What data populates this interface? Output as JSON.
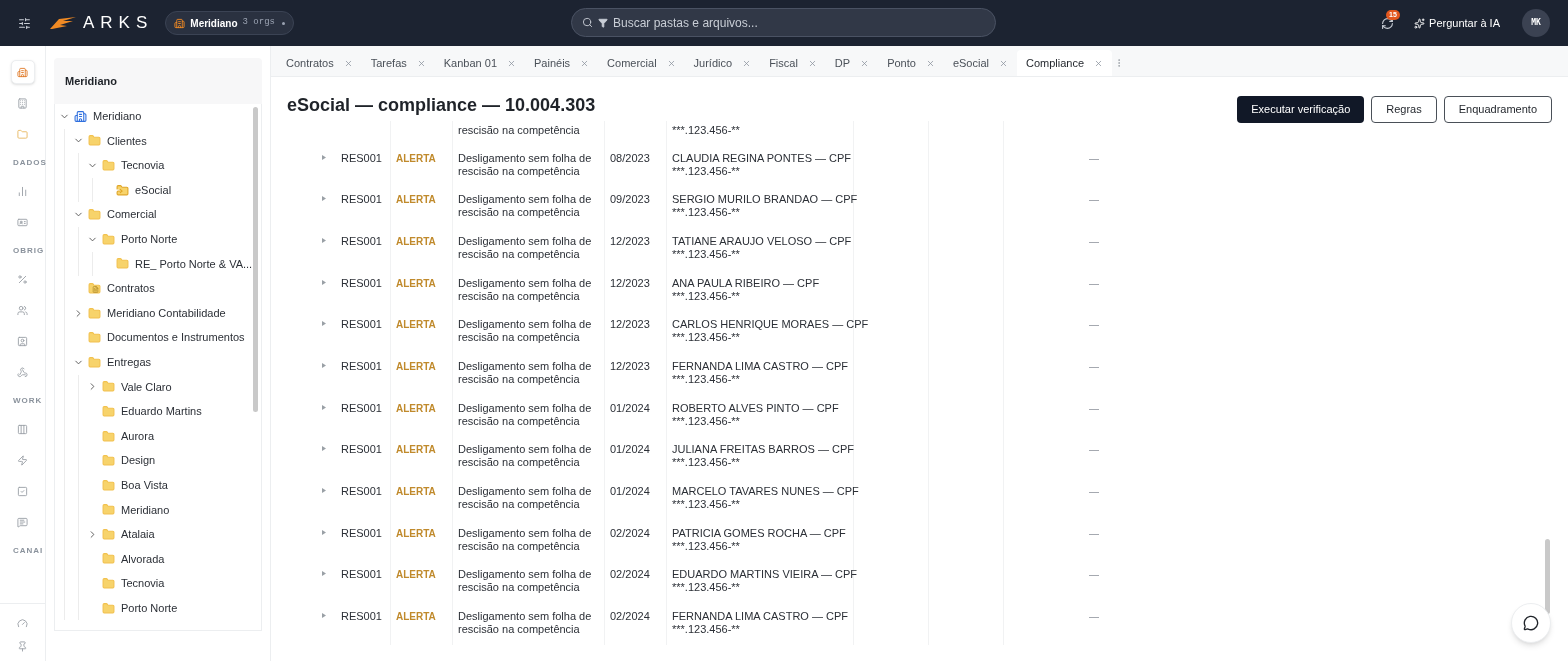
{
  "topbar": {
    "logo": "ARKS",
    "org": {
      "name": "Meridiano",
      "count": "3 orgs"
    },
    "search": {
      "placeholder": "Buscar pastas e arquivos..."
    },
    "notifications": {
      "badge": "15"
    },
    "ask_ai": "Perguntar à IA",
    "avatar": "MK"
  },
  "rail": [
    {
      "kind": "button",
      "selected": true
    },
    {
      "kind": "button",
      "selected": false
    },
    {
      "kind": "button",
      "selected": false
    },
    {
      "kind": "section",
      "label": "DADOS"
    },
    {
      "kind": "button",
      "selected": false
    },
    {
      "kind": "button",
      "selected": false
    },
    {
      "kind": "section",
      "label": "OBRIG"
    },
    {
      "kind": "button",
      "selected": false
    },
    {
      "kind": "button",
      "selected": false
    },
    {
      "kind": "button",
      "selected": false
    },
    {
      "kind": "button",
      "selected": false
    },
    {
      "kind": "section",
      "label": "WORK"
    },
    {
      "kind": "button",
      "selected": false
    },
    {
      "kind": "button",
      "selected": false
    },
    {
      "kind": "button",
      "selected": false
    },
    {
      "kind": "button",
      "selected": false
    },
    {
      "kind": "section",
      "label": "CANAI"
    }
  ],
  "sidebar": {
    "title": "Meridiano",
    "tree": [
      {
        "label": "Meridiano",
        "kind": "org",
        "expanded": true,
        "children": [
          {
            "label": "Clientes",
            "kind": "folder",
            "expanded": true,
            "children": [
              {
                "label": "Tecnovia",
                "kind": "folder",
                "expanded": true,
                "children": [
                  {
                    "label": "eSocial",
                    "kind": "shared-folder"
                  }
                ]
              }
            ]
          },
          {
            "label": "Comercial",
            "kind": "folder",
            "expanded": true,
            "children": [
              {
                "label": "Porto Norte",
                "kind": "folder",
                "expanded": true,
                "children": [
                  {
                    "label": "RE_ Porto Norte & VA...",
                    "kind": "folder"
                  }
                ]
              }
            ]
          },
          {
            "label": "Contratos",
            "kind": "doc-folder"
          },
          {
            "label": "Meridiano Contabilidade",
            "kind": "folder",
            "expanded": false
          },
          {
            "label": "Documentos e Instrumentos",
            "kind": "folder"
          },
          {
            "label": "Entregas",
            "kind": "folder",
            "expanded": true,
            "children": [
              {
                "label": "Vale Claro",
                "kind": "folder",
                "expanded": false
              },
              {
                "label": "Eduardo Martins",
                "kind": "folder"
              },
              {
                "label": "Aurora",
                "kind": "folder"
              },
              {
                "label": "Design",
                "kind": "folder"
              },
              {
                "label": "Boa Vista",
                "kind": "folder"
              },
              {
                "label": "Meridiano",
                "kind": "folder"
              },
              {
                "label": "Atalaia",
                "kind": "folder",
                "expanded": false
              },
              {
                "label": "Alvorada",
                "kind": "folder"
              },
              {
                "label": "Tecnovia",
                "kind": "folder"
              },
              {
                "label": "Porto Norte",
                "kind": "folder"
              }
            ]
          }
        ]
      }
    ]
  },
  "tabs": [
    {
      "label": "Contratos",
      "selected": false
    },
    {
      "label": "Tarefas",
      "selected": false
    },
    {
      "label": "Kanban 01",
      "selected": false
    },
    {
      "label": "Painéis",
      "selected": false
    },
    {
      "label": "Comercial",
      "selected": false
    },
    {
      "label": "Jurídico",
      "selected": false
    },
    {
      "label": "Fiscal",
      "selected": false
    },
    {
      "label": "DP",
      "selected": false
    },
    {
      "label": "Ponto",
      "selected": false
    },
    {
      "label": "eSocial",
      "selected": false
    },
    {
      "label": "Compliance",
      "selected": true
    }
  ],
  "page": {
    "title": "eSocial — compliance — 10.004.303",
    "actions": [
      {
        "label": "Executar verificação",
        "kind": "primary"
      },
      {
        "label": "Regras",
        "kind": "outline"
      },
      {
        "label": "Enquadramento",
        "kind": "outline"
      }
    ]
  },
  "table": {
    "partial_row": {
      "description": "rescisão na competência",
      "cpf": "***.123.456-**"
    },
    "rows": [
      {
        "rule": "RES001",
        "severity": "ALERTA",
        "description": "Desligamento sem folha de rescisão na competência",
        "period": "08/2023",
        "person": "CLAUDIA REGINA PONTES — CPF",
        "cpf": "***.123.456-**",
        "column_9": "—"
      },
      {
        "rule": "RES001",
        "severity": "ALERTA",
        "description": "Desligamento sem folha de rescisão na competência",
        "period": "09/2023",
        "person": "SERGIO MURILO BRANDAO — CPF",
        "cpf": "***.123.456-**",
        "column_9": "—"
      },
      {
        "rule": "RES001",
        "severity": "ALERTA",
        "description": "Desligamento sem folha de rescisão na competência",
        "period": "12/2023",
        "person": "TATIANE ARAUJO VELOSO — CPF",
        "cpf": "***.123.456-**",
        "column_9": "—"
      },
      {
        "rule": "RES001",
        "severity": "ALERTA",
        "description": "Desligamento sem folha de rescisão na competência",
        "period": "12/2023",
        "person": "ANA PAULA RIBEIRO — CPF",
        "cpf": "***.123.456-**",
        "column_9": "—"
      },
      {
        "rule": "RES001",
        "severity": "ALERTA",
        "description": "Desligamento sem folha de rescisão na competência",
        "period": "12/2023",
        "person": "CARLOS HENRIQUE MORAES — CPF",
        "cpf": "***.123.456-**",
        "column_9": "—"
      },
      {
        "rule": "RES001",
        "severity": "ALERTA",
        "description": "Desligamento sem folha de rescisão na competência",
        "period": "12/2023",
        "person": "FERNANDA LIMA CASTRO — CPF",
        "cpf": "***.123.456-**",
        "column_9": "—"
      },
      {
        "rule": "RES001",
        "severity": "ALERTA",
        "description": "Desligamento sem folha de rescisão na competência",
        "period": "01/2024",
        "person": "ROBERTO ALVES PINTO — CPF",
        "cpf": "***.123.456-**",
        "column_9": "—"
      },
      {
        "rule": "RES001",
        "severity": "ALERTA",
        "description": "Desligamento sem folha de rescisão na competência",
        "period": "01/2024",
        "person": "JULIANA FREITAS BARROS — CPF",
        "cpf": "***.123.456-**",
        "column_9": "—"
      },
      {
        "rule": "RES001",
        "severity": "ALERTA",
        "description": "Desligamento sem folha de rescisão na competência",
        "period": "01/2024",
        "person": "MARCELO TAVARES NUNES — CPF",
        "cpf": "***.123.456-**",
        "column_9": "—"
      },
      {
        "rule": "RES001",
        "severity": "ALERTA",
        "description": "Desligamento sem folha de rescisão na competência",
        "period": "02/2024",
        "person": "PATRICIA GOMES ROCHA — CPF",
        "cpf": "***.123.456-**",
        "column_9": "—"
      },
      {
        "rule": "RES001",
        "severity": "ALERTA",
        "description": "Desligamento sem folha de rescisão na competência",
        "period": "02/2024",
        "person": "EDUARDO MARTINS VIEIRA — CPF",
        "cpf": "***.123.456-**",
        "column_9": "—"
      },
      {
        "rule": "RES001",
        "severity": "ALERTA",
        "description": "Desligamento sem folha de rescisão na competência",
        "period": "02/2024",
        "person": "FERNANDA LIMA CASTRO — CPF",
        "cpf": "***.123.456-**",
        "column_9": "—"
      }
    ]
  }
}
